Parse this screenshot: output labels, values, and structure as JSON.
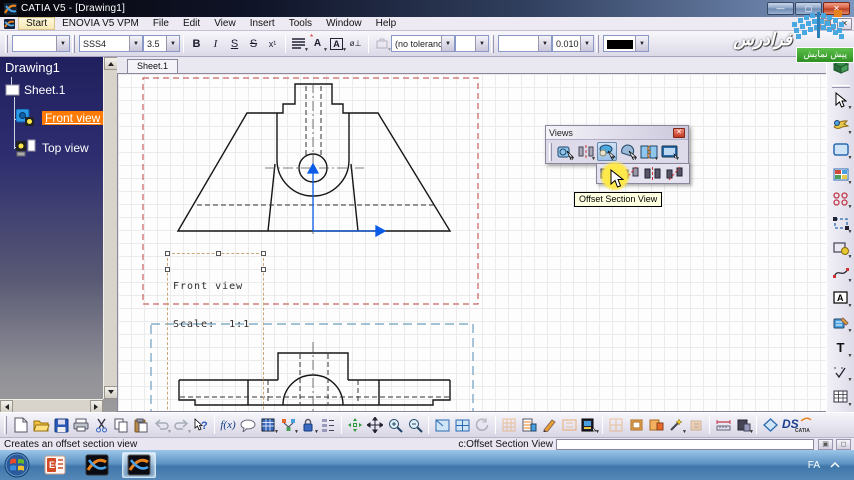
{
  "window": {
    "title": "CATIA V5 - [Drawing1]"
  },
  "menu": {
    "items": [
      "Start",
      "ENOVIA V5 VPM",
      "File",
      "Edit",
      "View",
      "Insert",
      "Tools",
      "Window",
      "Help"
    ]
  },
  "format_toolbar": {
    "style_value": "",
    "font_value": "SSS4",
    "size_value": "3.5",
    "bold": "B",
    "italic": "I",
    "underline": "S",
    "strikethrough": "S",
    "superscript": "x¹",
    "symbol": "ø⊥",
    "tolerance_value": "(no tolerance)",
    "tolerance_type_value": "",
    "dimension_style_value": "",
    "precision_value": "0.010"
  },
  "watermark": {
    "brand": "فرادرس",
    "badge": "پیش نمایش"
  },
  "tree": {
    "root": "Drawing1",
    "items": [
      {
        "label": "Sheet.1"
      },
      {
        "label": "Front view",
        "selected": true
      },
      {
        "label": "Top view"
      }
    ]
  },
  "sheet_tabs": {
    "active": "Sheet.1"
  },
  "views_palette": {
    "title": "Views",
    "tooltip": "Offset Section View",
    "main_icons": [
      "front-view-icon",
      "unfolded-view-icon",
      "detail-view-icon",
      "clipping-view-icon",
      "broken-view-icon",
      "view-wizard-icon"
    ],
    "flyout_icons": [
      "offset-section-view-icon",
      "aligned-section-view-icon",
      "offset-section-cut-icon",
      "aligned-section-cut-icon"
    ]
  },
  "drawing": {
    "front_view_label": {
      "line1": "Front view",
      "line2": "Scale:  1:1"
    }
  },
  "statusbar": {
    "message": "Creates an offset section view",
    "command_label": "c:Offset Section View",
    "command_value": ""
  },
  "branding": {
    "ds_logo": "DS",
    "ds_caption": "CATIA"
  },
  "taskbar": {
    "language": "FA"
  },
  "colors": {
    "selection_orange": "#ff7a00",
    "front_frame_red": "#c04040",
    "top_frame_blue": "#6f9fc0",
    "axis_blue": "#0a5ce8",
    "tooltip_bg": "#ffffe1",
    "tree_top": "#20205e",
    "taskbar_blue": "#5e93c4"
  },
  "standard_toolbar_icons": [
    "new-document-icon",
    "open-folder-icon",
    "save-icon",
    "print-icon",
    "cut-icon",
    "copy-icon",
    "paste-icon",
    "undo-icon",
    "redo-icon",
    "whats-this-icon",
    "fx-icon",
    "chat-icon",
    "table-icon",
    "graph-nodes-icon",
    "lock-icon",
    "structure-icon",
    "fit-all-icon",
    "pan-icon",
    "zoom-in-icon",
    "zoom-out-icon",
    "normal-view-icon",
    "multi-view-icon",
    "rotate-icon",
    "grid-icon",
    "snap-to-grid-icon",
    "analysis-icon",
    "frame-icon",
    "view-mode-icon",
    "grid2-icon",
    "box-icon",
    "box2-icon",
    "wand-icon",
    "ruler-icon",
    "measure-icon",
    "diamond-icon"
  ],
  "right_toolbar_icons": [
    "sheet-icon",
    "select-arrow-icon",
    "fly-icon",
    "view-frame-icon",
    "window-panes-icon",
    "points-icon",
    "dashed-frame-icon",
    "frame-lock-icon",
    "spline-icon",
    "text-frame-icon",
    "dimension-icon",
    "text-icon",
    "check-dashed-icon",
    "grid-table-icon"
  ]
}
